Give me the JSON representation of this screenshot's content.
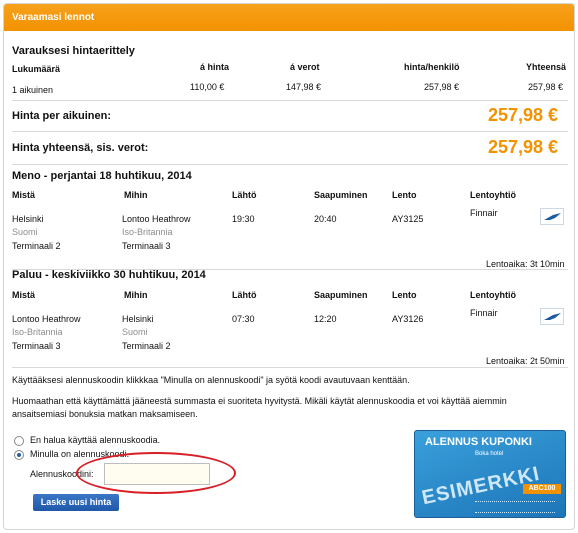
{
  "panel": {
    "title": "Varaamasi lennot"
  },
  "breakdown": {
    "title": "Varauksesi hintaerittely",
    "headers": {
      "count": "Lukumäärä",
      "price": "á hinta",
      "taxes": "á verot",
      "per_person": "hinta/henkilö",
      "total": "Yhteensä"
    },
    "row": {
      "count": "1 aikuinen",
      "price": "110,00 €",
      "taxes": "147,98 €",
      "per_person": "257,98 €",
      "total": "257,98 €"
    }
  },
  "totals": {
    "per_adult_label": "Hinta per aikuinen:",
    "per_adult_value": "257,98 €",
    "grand_label": "Hinta yhteensä, sis. verot:",
    "grand_value": "257,98 €"
  },
  "flight_headers": {
    "from": "Mistä",
    "to": "Mihin",
    "dep": "Lähtö",
    "arr": "Saapuminen",
    "flight": "Lento",
    "airline": "Lentoyhtiö"
  },
  "outbound": {
    "title": "Meno - perjantai 18 huhtikuu, 2014",
    "from_city": "Helsinki",
    "from_country": "Suomi",
    "from_terminal": "Terminaali 2",
    "to_city": "Lontoo Heathrow",
    "to_country": "Iso-Britannia",
    "to_terminal": "Terminaali 3",
    "dep": "19:30",
    "arr": "20:40",
    "flight": "AY3125",
    "airline": "Finnair",
    "duration": "Lentoaika: 3t 10min"
  },
  "return": {
    "title": "Paluu - keskiviikko 30 huhtikuu, 2014",
    "from_city": "Lontoo Heathrow",
    "from_country": "Iso-Britannia",
    "from_terminal": "Terminaali 3",
    "to_city": "Helsinki",
    "to_country": "Suomi",
    "to_terminal": "Terminaali 2",
    "dep": "07:30",
    "arr": "12:20",
    "flight": "AY3126",
    "airline": "Finnair",
    "duration": "Lentoaika: 2t 50min"
  },
  "discount": {
    "info1": "Käyttääksesi alennuskoodin klikkkaa \"Minulla on alennuskoodi\" ja syötä koodi avautuvaan kenttään.",
    "info2a": "Huomaathan että käyttämättä jääneestä summasta ei suoriteta hyvitystä. Mikäli käytät alennuskoodia et voi käyttää aiemmin",
    "info2b": "ansaitsemiasi bonuksia matkan maksamiseen.",
    "option_no": "En halua käyttää alennuskoodia.",
    "option_yes": "Minulla on alennuskoodi.",
    "code_label": "Alennuskoodini:",
    "code_value": "",
    "button": "Laske uusi hinta"
  },
  "coupon": {
    "title": "ALENNUS KUPONKI",
    "subtitle": "Boka hotel",
    "stamp": "ESIMERKKI",
    "code": "ABC100"
  }
}
